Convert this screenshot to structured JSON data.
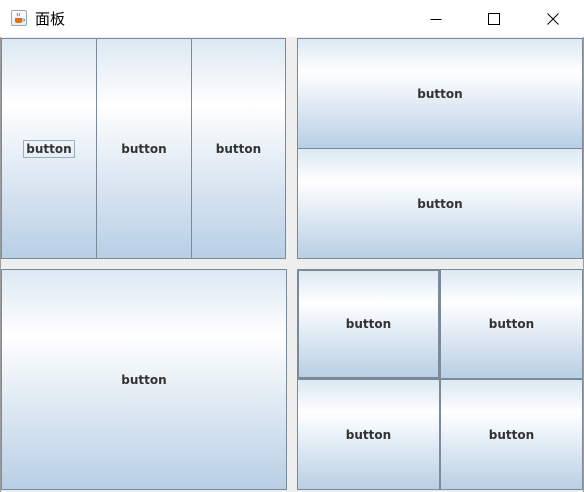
{
  "window": {
    "title": "面板",
    "icon": "java-cup-icon",
    "controls": [
      "minimize-icon",
      "maximize-icon",
      "close-icon"
    ]
  },
  "panels": {
    "top_left": {
      "layout": "1x3 grid",
      "buttons": [
        "button",
        "button",
        "button"
      ]
    },
    "top_right": {
      "layout": "2x1 grid",
      "buttons": [
        "button",
        "button"
      ]
    },
    "bottom_left": {
      "layout": "single",
      "buttons": [
        "button"
      ]
    },
    "bottom_right": {
      "layout": "2x2 grid",
      "buttons": [
        "button",
        "button",
        "button",
        "button"
      ]
    }
  },
  "colors": {
    "button_border": "#7a8a99",
    "button_gradient_top": "#dce8f3",
    "button_gradient_mid": "#ffffff",
    "button_gradient_bottom": "#b8cfe5",
    "label_text": "#333333",
    "window_bg": "#eeeeee"
  }
}
